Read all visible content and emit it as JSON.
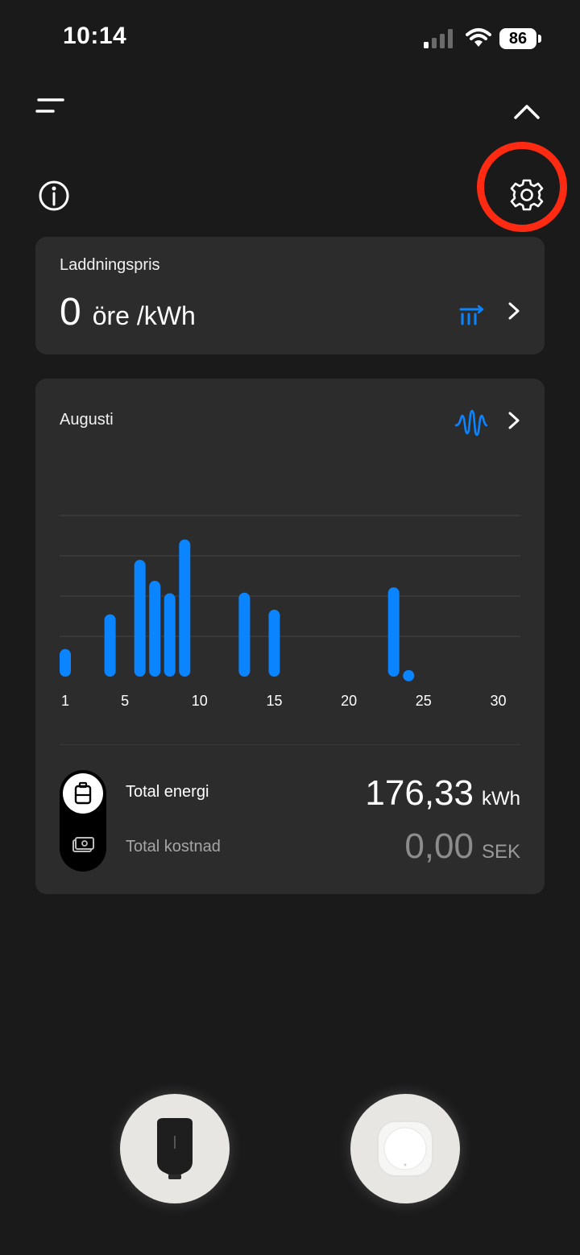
{
  "status_bar": {
    "time": "10:14",
    "battery": "86"
  },
  "price_card": {
    "title": "Laddningspris",
    "value": "0",
    "unit": "öre /kWh"
  },
  "energy_card": {
    "month": "Augusti",
    "total_energy_label": "Total energi",
    "total_energy_value": "176,33",
    "total_energy_unit": "kWh",
    "total_cost_label": "Total kostnad",
    "total_cost_value": "0,00",
    "total_cost_unit": "SEK"
  },
  "colors": {
    "background": "#1a1a1a",
    "card": "#2c2c2c",
    "accent_blue": "#0a84ff",
    "highlight_red": "#ff2a12"
  },
  "icons": {
    "menu": "menu-icon",
    "collapse": "chevron-up-icon",
    "info": "info-icon",
    "settings": "gear-icon",
    "price_chart": "price-chart-icon",
    "wave": "wave-icon",
    "battery": "battery-icon",
    "cash": "cash-icon",
    "charger": "charger-icon",
    "sensor": "sensor-icon"
  },
  "chart_data": {
    "type": "bar",
    "x": [
      1,
      4,
      6,
      7,
      8,
      9,
      13,
      15,
      23,
      24
    ],
    "values": [
      4.2,
      9.5,
      17.8,
      14.6,
      12.7,
      20.9,
      12.8,
      10.2,
      13.6,
      1.0
    ],
    "xticks": [
      "1",
      "5",
      "10",
      "15",
      "20",
      "25",
      "30"
    ],
    "xtick_values": [
      1,
      5,
      10,
      15,
      20,
      25,
      30
    ],
    "xlim": [
      1,
      31
    ],
    "ylim": [
      0,
      27
    ],
    "grid": true,
    "color": "#0a84ff"
  }
}
